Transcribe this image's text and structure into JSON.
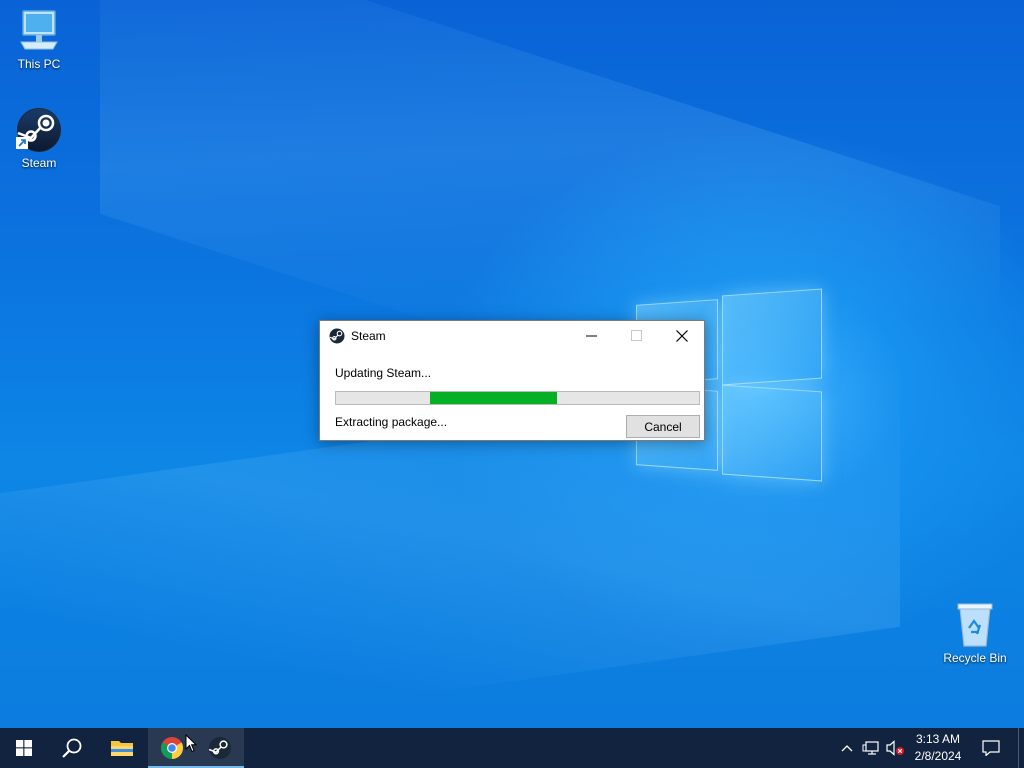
{
  "desktop": {
    "icons": [
      {
        "label": "This PC",
        "icon": "computer-icon"
      },
      {
        "label": "Steam",
        "icon": "steam-icon"
      },
      {
        "label": "Recycle Bin",
        "icon": "recycle-bin-icon"
      }
    ]
  },
  "dialog": {
    "title": "Steam",
    "status_text": "Updating Steam...",
    "detail_text": "Extracting package...",
    "cancel_label": "Cancel",
    "progress_color": "#06b025"
  },
  "taskbar": {
    "apps": [
      {
        "name": "Start",
        "icon": "windows-start-icon"
      },
      {
        "name": "Search",
        "icon": "search-icon"
      },
      {
        "name": "File Explorer",
        "icon": "folder-icon"
      },
      {
        "name": "Google Chrome",
        "icon": "chrome-icon"
      },
      {
        "name": "Steam",
        "icon": "steam-icon"
      }
    ],
    "tray": {
      "time": "3:13 AM",
      "date": "2/8/2024"
    }
  },
  "colors": {
    "desktop_accent": "#0b74df",
    "taskbar": "#121e34"
  }
}
